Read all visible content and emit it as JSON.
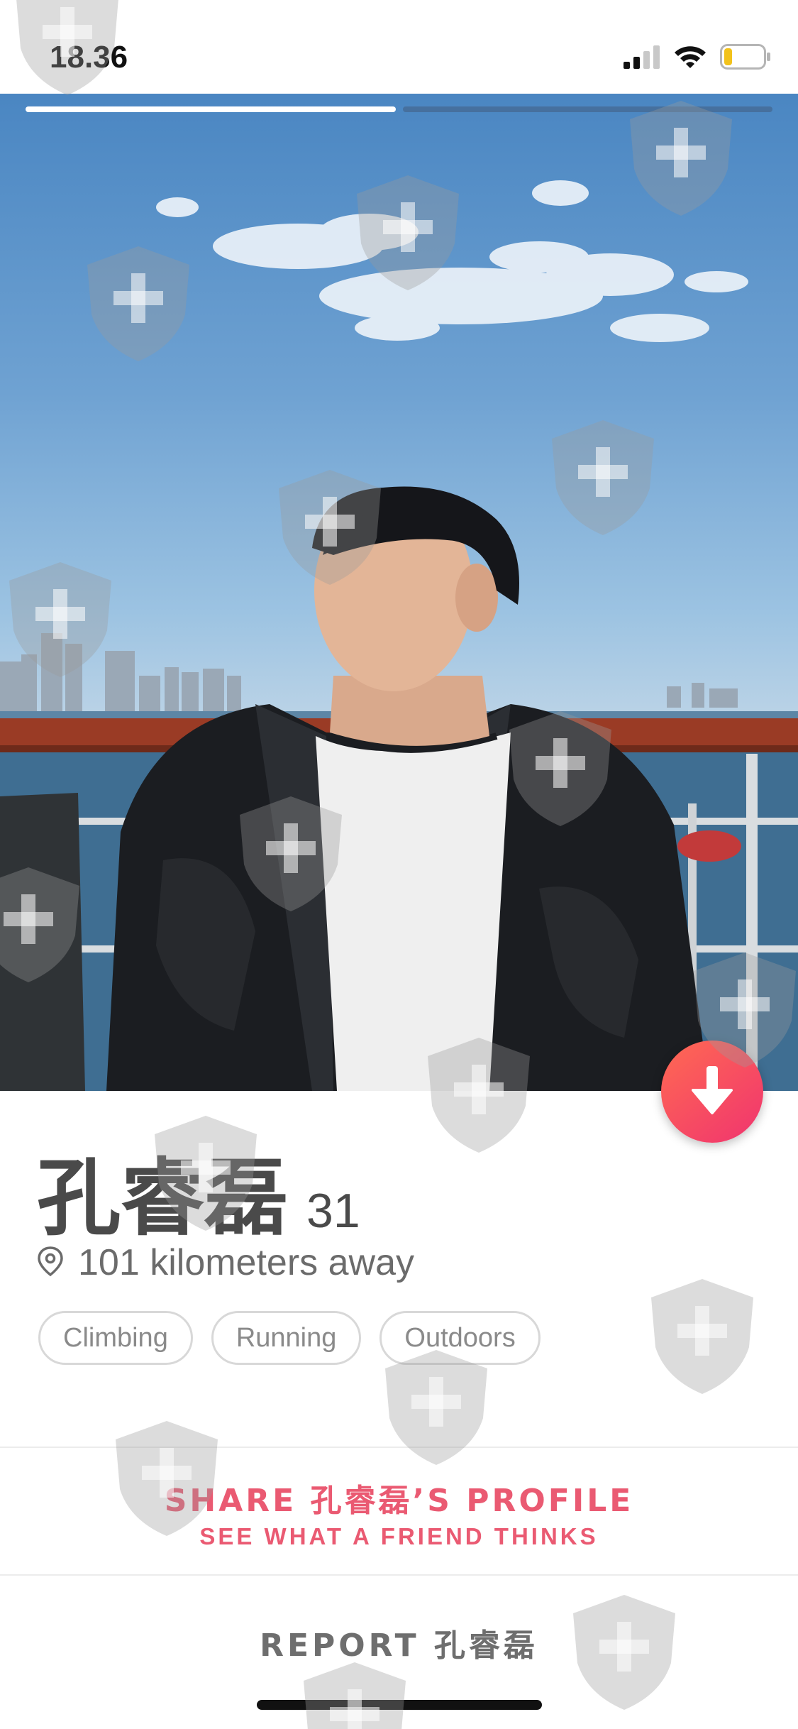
{
  "status_bar": {
    "time": "18.36",
    "signal_icon": "cellular-signal-icon",
    "wifi_icon": "wifi-icon",
    "battery_icon": "battery-low-icon",
    "battery_level": 0.15
  },
  "photo": {
    "image_description_icon": "profile-photo",
    "progress": {
      "total": 2,
      "active_index": 0
    }
  },
  "profile": {
    "name": "孔睿磊",
    "age": "31",
    "location_icon": "location-pin-icon",
    "distance": "101 kilometers away",
    "interests": [
      "Climbing",
      "Running",
      "Outdoors"
    ]
  },
  "actions": {
    "collapse_icon": "arrow-down-icon",
    "share_title": "SHARE 孔睿磊’S PROFILE",
    "share_subtitle": "SEE WHAT A FRIEND THINKS",
    "report_label": "REPORT 孔睿磊"
  },
  "colors": {
    "accent_start": "#ff6a52",
    "accent_end": "#f0346f",
    "share_text": "#ea5a72",
    "body_text": "#4a4a4a"
  }
}
